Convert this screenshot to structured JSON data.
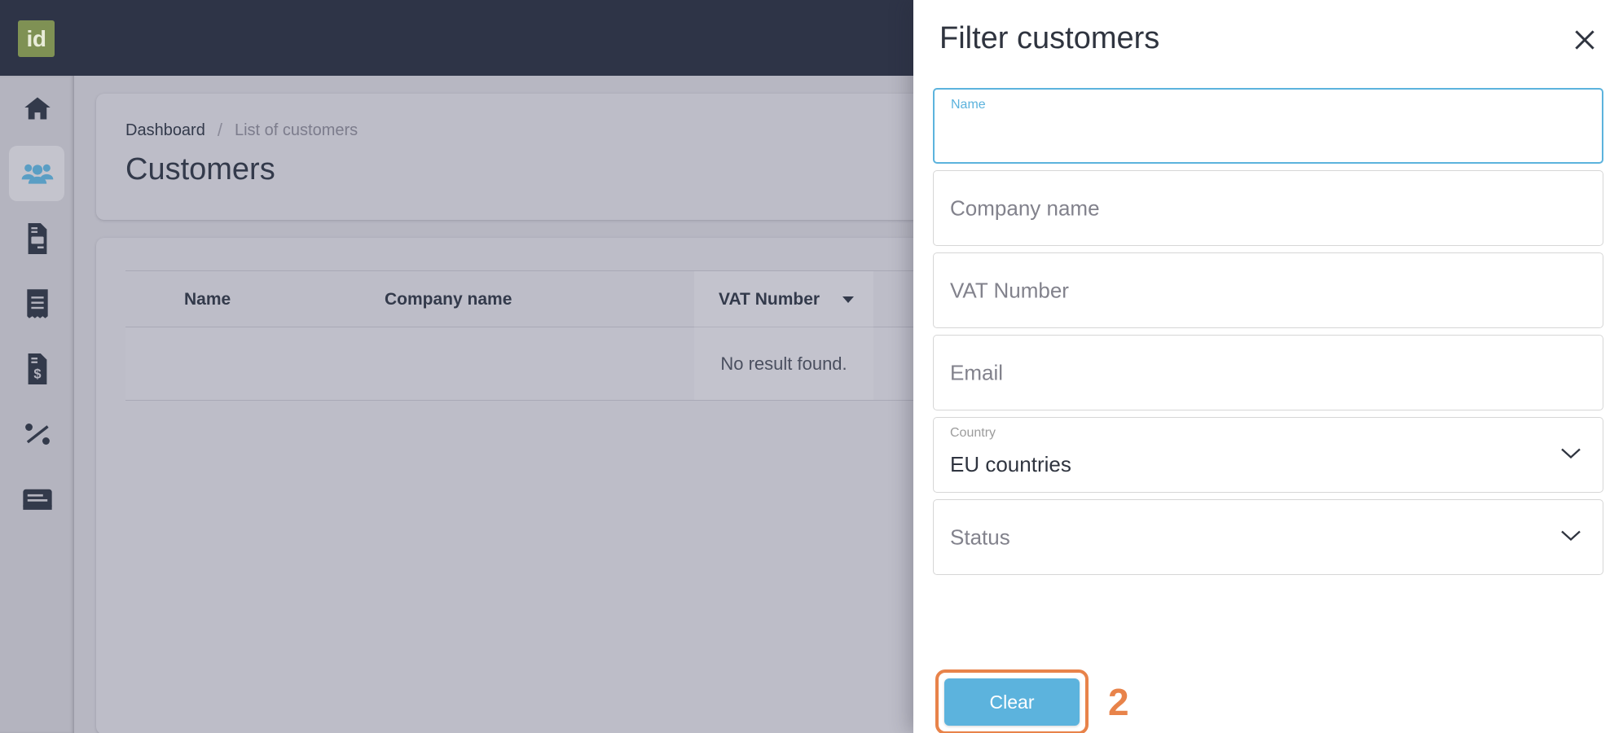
{
  "brand": {
    "logo_text": "id",
    "logo_color": "#7f9154",
    "topbar_color": "#2e3447"
  },
  "theme": {
    "accent": "#5cb3dd",
    "annotation": "#e8834a",
    "page_bg": "#b7b7c2",
    "card_bg": "#bdbdc8"
  },
  "sidebar": {
    "items": [
      {
        "label": "Dashboard",
        "icon": "home-icon",
        "active": false
      },
      {
        "label": "Customers",
        "icon": "users-icon",
        "active": true
      },
      {
        "label": "Quotes",
        "icon": "file-invoice-icon",
        "active": false
      },
      {
        "label": "Receipts",
        "icon": "receipt-icon",
        "active": false
      },
      {
        "label": "Invoices",
        "icon": "file-dollar-icon",
        "active": false
      },
      {
        "label": "Taxes",
        "icon": "percent-icon",
        "active": false
      },
      {
        "label": "Ledger",
        "icon": "card-icon",
        "active": false
      }
    ]
  },
  "breadcrumb": {
    "root": "Dashboard",
    "separator": "/",
    "current": "List of customers"
  },
  "page": {
    "title": "Customers"
  },
  "table": {
    "columns": [
      "Name",
      "Company name",
      "VAT Number"
    ],
    "sort_column": "VAT Number",
    "sort_caret": "chevron-down-icon",
    "empty_message": "No result found.",
    "rows": []
  },
  "modal": {
    "title": "Filter customers",
    "close_icon": "close-icon",
    "fields": [
      {
        "name": "name",
        "label": "Name",
        "value": "",
        "placeholder": "Name",
        "type": "text",
        "focused": true
      },
      {
        "name": "company_name",
        "label": "Company name",
        "value": "",
        "placeholder": "Company name",
        "type": "text",
        "focused": false
      },
      {
        "name": "vat_number",
        "label": "VAT Number",
        "value": "",
        "placeholder": "VAT Number",
        "type": "text",
        "focused": false
      },
      {
        "name": "email",
        "label": "Email",
        "value": "",
        "placeholder": "Email",
        "type": "text",
        "focused": false
      },
      {
        "name": "country",
        "label": "Country",
        "value": "EU countries",
        "placeholder": "Country",
        "type": "select",
        "focused": false
      },
      {
        "name": "status",
        "label": "Status",
        "value": "",
        "placeholder": "Status",
        "type": "select",
        "focused": false
      }
    ],
    "clear_label": "Clear"
  },
  "annotation": {
    "step_number": "2"
  }
}
